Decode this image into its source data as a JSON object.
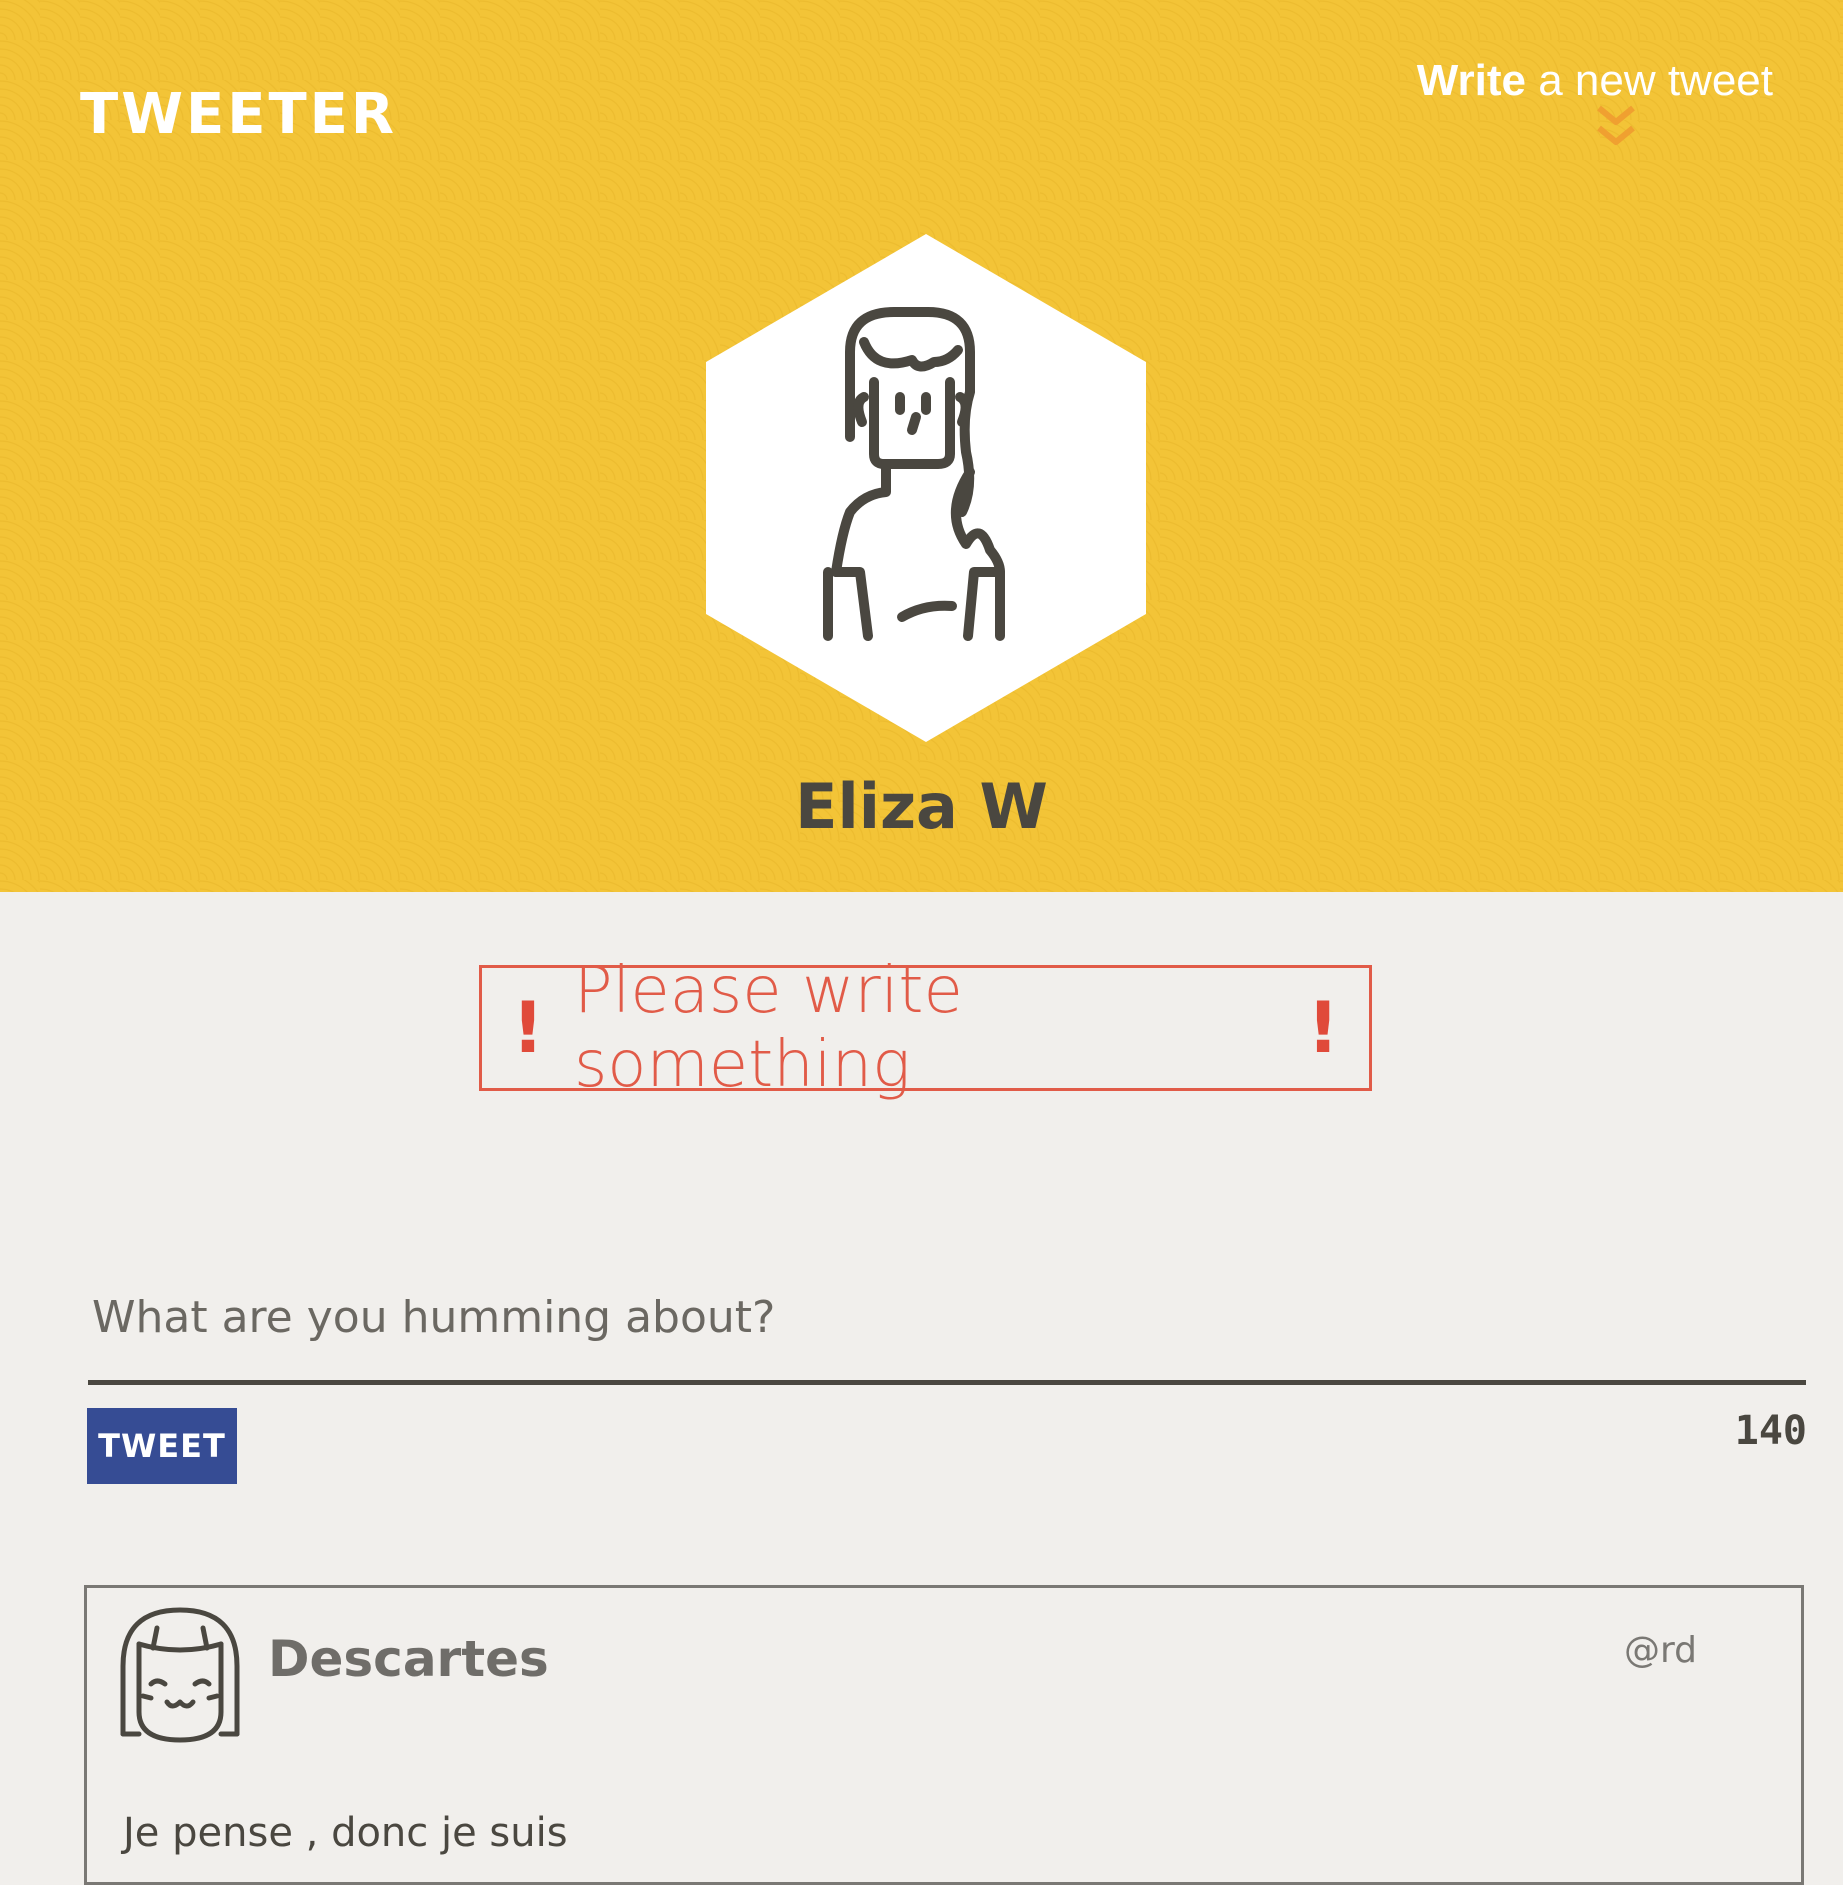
{
  "header": {
    "logo": "TWEETER",
    "compose_link_strong": "Write",
    "compose_link_rest": " a new tweet"
  },
  "profile": {
    "name": "Eliza W"
  },
  "error": {
    "message": "Please write something",
    "icon_left": "!",
    "icon_right": "!"
  },
  "composer": {
    "placeholder": "What are you humming about?",
    "value": "",
    "button_label": "TWEET",
    "char_count": "140"
  },
  "feed": [
    {
      "author": "Descartes",
      "handle": "@rd",
      "text": "Je pense , donc je suis"
    }
  ],
  "colors": {
    "header_yellow": "#f3c437",
    "error_red": "#e15b48",
    "button_blue": "#364c94",
    "chevron_orange": "#f0a030",
    "page_bg": "#f1efec",
    "text_dark": "#4a4740"
  },
  "icons": {
    "compose_chevron": "double-chevron-down-icon",
    "profile_avatar": "girl-avatar-icon",
    "tweet_avatar": "smiling-face-avatar-icon"
  }
}
